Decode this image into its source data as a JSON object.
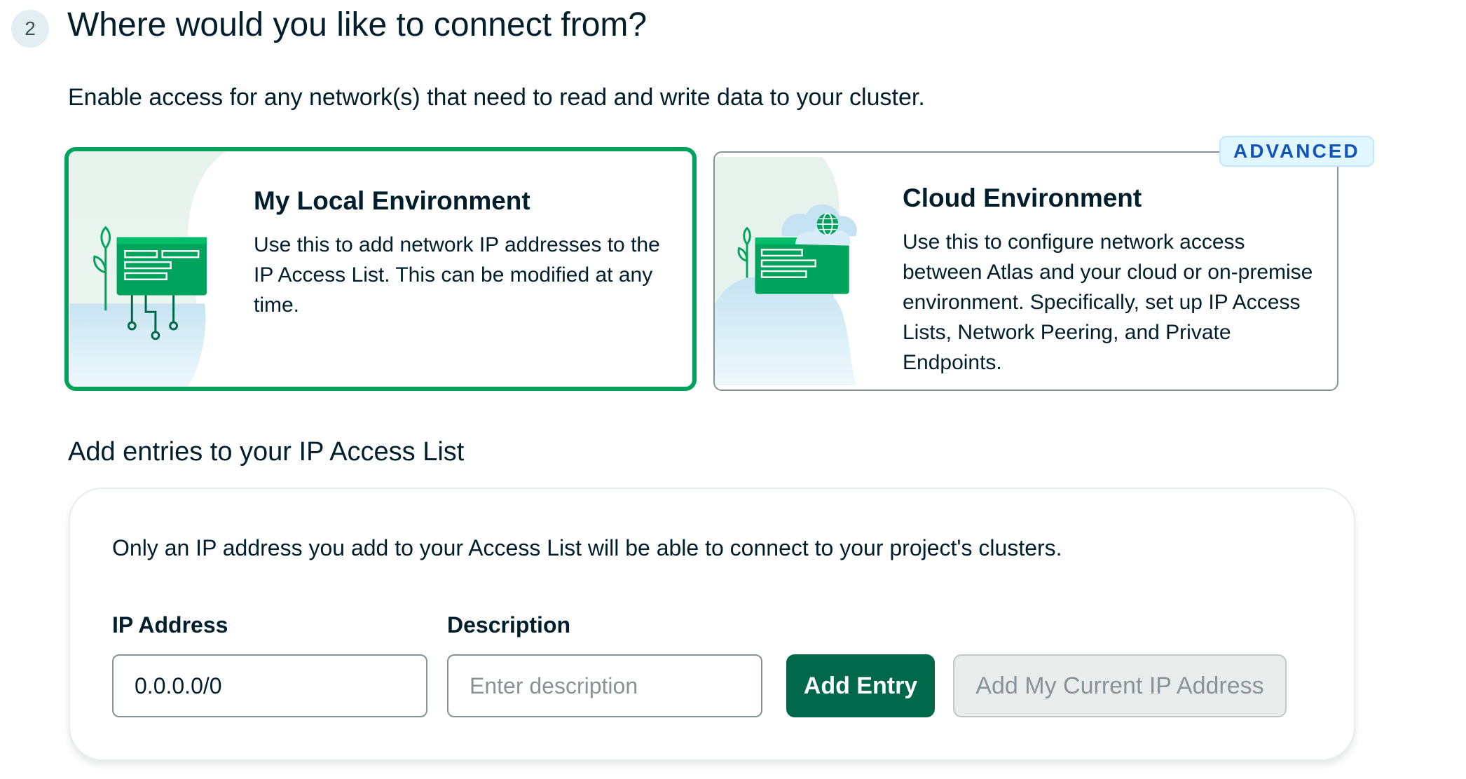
{
  "step": {
    "number": "2",
    "title": "Where would you like to connect from?",
    "description": "Enable access for any network(s) that need to read and write data to your cluster."
  },
  "environments": {
    "local": {
      "title": "My Local Environment",
      "body": "Use this to add network IP addresses to the IP Access List. This can be modified at any time.",
      "selected": true
    },
    "cloud": {
      "badge": "ADVANCED",
      "title": "Cloud Environment",
      "body": "Use this to configure network access between Atlas and your cloud or on-premise environment. Specifically, set up IP Access Lists, Network Peering, and Private Endpoints.",
      "selected": false
    }
  },
  "ip_access": {
    "section_title": "Add entries to your IP Access List",
    "note": "Only an IP address you add to your Access List will be able to connect to your project's clusters.",
    "ip_label": "IP Address",
    "ip_value": "0.0.0.0/0",
    "description_label": "Description",
    "description_placeholder": "Enter description",
    "add_entry_label": "Add Entry",
    "add_current_ip_label": "Add My Current IP Address"
  },
  "colors": {
    "selected_border": "#00a35c",
    "primary_button": "#00684a",
    "badge_text": "#1254b7",
    "badge_bg": "#e1f7ff"
  }
}
